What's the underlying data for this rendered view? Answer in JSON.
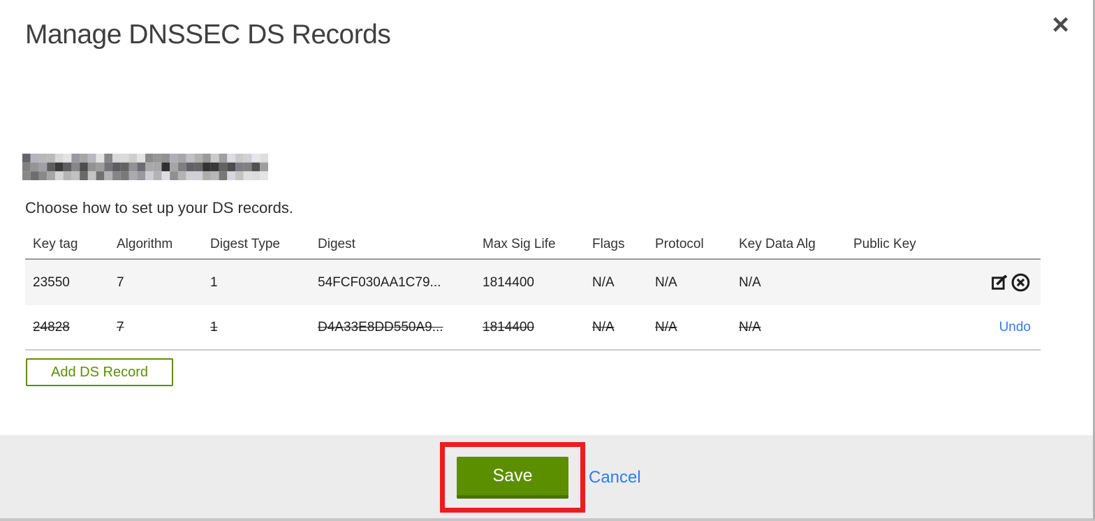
{
  "modal": {
    "title": "Manage DNSSEC DS Records",
    "close_icon": "×",
    "instruction": "Choose how to set up your DS records.",
    "add_button_label": "Add DS Record",
    "save_label": "Save",
    "cancel_label": "Cancel"
  },
  "table": {
    "columns": [
      "Key tag",
      "Algorithm",
      "Digest Type",
      "Digest",
      "Max Sig Life",
      "Flags",
      "Protocol",
      "Key Data Alg",
      "Public Key"
    ],
    "rows": [
      {
        "key_tag": "23550",
        "algorithm": "7",
        "digest_type": "1",
        "digest": "54FCF030AA1C79...",
        "max_sig_life": "1814400",
        "flags": "N/A",
        "protocol": "N/A",
        "key_data_alg": "N/A",
        "public_key": "",
        "state": "active",
        "actions": "edit-delete"
      },
      {
        "key_tag": "24828",
        "algorithm": "7",
        "digest_type": "1",
        "digest": "D4A33E8DD550A9...",
        "max_sig_life": "1814400",
        "flags": "N/A",
        "protocol": "N/A",
        "key_data_alg": "N/A",
        "public_key": "",
        "state": "deleted",
        "actions": "undo",
        "undo_label": "Undo"
      }
    ]
  },
  "colors": {
    "accent_green": "#5c8f00",
    "accent_green_dark": "#4a7300",
    "link_blue": "#2f7bf6",
    "annotation_red": "#ee1c1c",
    "footer_gray": "#ececec",
    "row_gray": "#f5f5f5"
  }
}
